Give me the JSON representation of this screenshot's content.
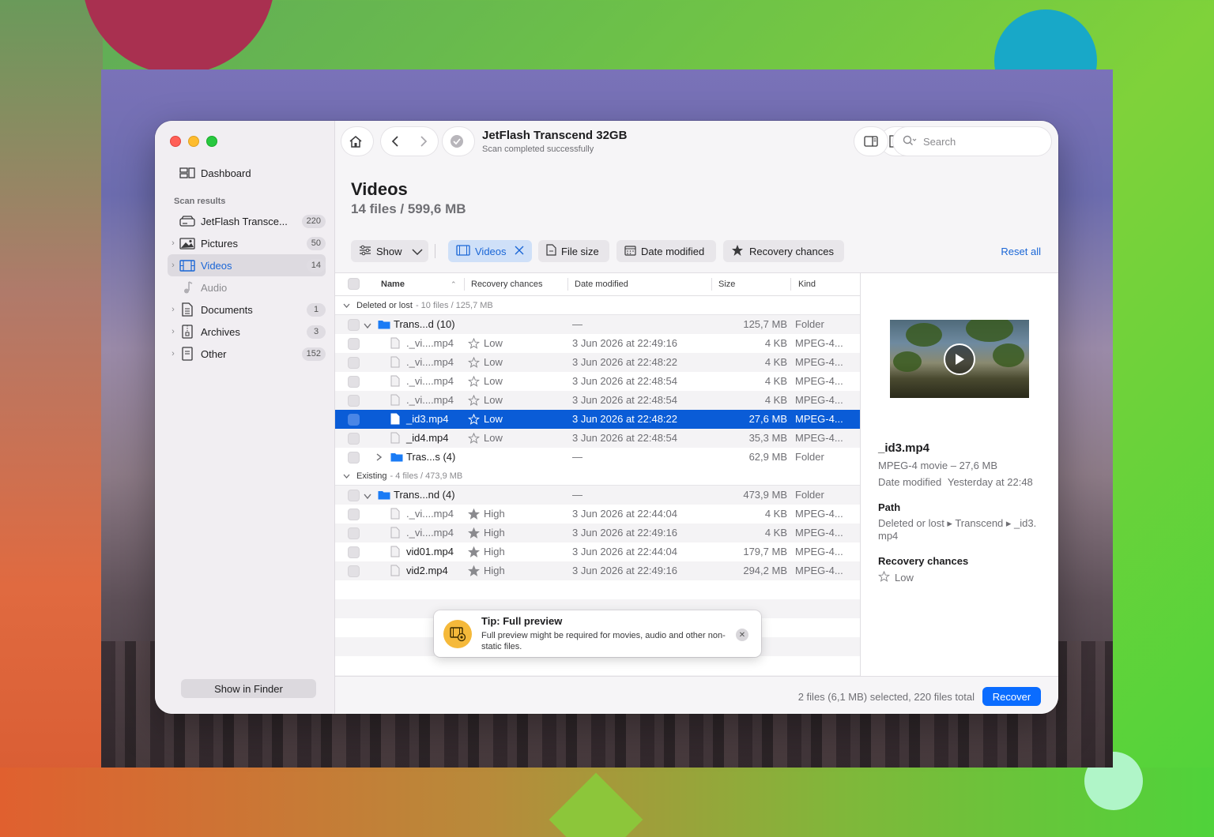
{
  "toolbar": {
    "drive_title": "JetFlash Transcend 32GB",
    "status": "Scan completed successfully",
    "search_placeholder": "Search"
  },
  "sidebar": {
    "dashboard": "Dashboard",
    "section_label": "Scan results",
    "items": [
      {
        "label": "JetFlash Transce...",
        "count": "220",
        "icon": "drive-icon"
      },
      {
        "label": "Pictures",
        "count": "50",
        "icon": "pictures-icon"
      },
      {
        "label": "Videos",
        "count": "14",
        "icon": "film-icon"
      },
      {
        "label": "Audio",
        "count": "",
        "icon": "music-note-icon"
      },
      {
        "label": "Documents",
        "count": "1",
        "icon": "document-icon"
      },
      {
        "label": "Archives",
        "count": "3",
        "icon": "archive-icon"
      },
      {
        "label": "Other",
        "count": "152",
        "icon": "other-icon"
      }
    ],
    "show_in_finder": "Show in Finder"
  },
  "header": {
    "title": "Videos",
    "subtitle": "14 files / 599,6 MB"
  },
  "filters": {
    "show": "Show",
    "videos": "Videos",
    "file_size": "File size",
    "date_modified": "Date modified",
    "recovery_chances": "Recovery chances",
    "reset_all": "Reset all"
  },
  "table": {
    "columns": [
      "Name",
      "Recovery chances",
      "Date modified",
      "Size",
      "Kind"
    ],
    "groups": [
      {
        "label": "Deleted or lost",
        "meta": "- 10 files / 125,7 MB"
      },
      {
        "label": "Existing",
        "meta": "- 4 files / 473,9 MB"
      }
    ],
    "rows_deleted": [
      {
        "name": "Trans...d (10)",
        "chance": "",
        "date": "—",
        "size": "125,7 MB",
        "kind": "Folder"
      },
      {
        "name": "._vi....mp4",
        "chance": "Low",
        "date": "3 Jun 2026 at 22:49:16",
        "size": "4 KB",
        "kind": "MPEG-4..."
      },
      {
        "name": "._vi....mp4",
        "chance": "Low",
        "date": "3 Jun 2026 at 22:48:22",
        "size": "4 KB",
        "kind": "MPEG-4..."
      },
      {
        "name": "._vi....mp4",
        "chance": "Low",
        "date": "3 Jun 2026 at 22:48:54",
        "size": "4 KB",
        "kind": "MPEG-4..."
      },
      {
        "name": "._vi....mp4",
        "chance": "Low",
        "date": "3 Jun 2026 at 22:48:54",
        "size": "4 KB",
        "kind": "MPEG-4..."
      },
      {
        "name": "_id3.mp4",
        "chance": "Low",
        "date": "3 Jun 2026 at 22:48:22",
        "size": "27,6 MB",
        "kind": "MPEG-4..."
      },
      {
        "name": "_id4.mp4",
        "chance": "Low",
        "date": "3 Jun 2026 at 22:48:54",
        "size": "35,3 MB",
        "kind": "MPEG-4..."
      },
      {
        "name": "Tras...s (4)",
        "chance": "",
        "date": "—",
        "size": "62,9 MB",
        "kind": "Folder"
      }
    ],
    "rows_existing": [
      {
        "name": "Trans...nd (4)",
        "chance": "",
        "date": "—",
        "size": "473,9 MB",
        "kind": "Folder"
      },
      {
        "name": "._vi....mp4",
        "chance": "High",
        "date": "3 Jun 2026 at 22:44:04",
        "size": "4 KB",
        "kind": "MPEG-4..."
      },
      {
        "name": "._vi....mp4",
        "chance": "High",
        "date": "3 Jun 2026 at 22:49:16",
        "size": "4 KB",
        "kind": "MPEG-4..."
      },
      {
        "name": "vid01.mp4",
        "chance": "High",
        "date": "3 Jun 2026 at 22:44:04",
        "size": "179,7 MB",
        "kind": "MPEG-4..."
      },
      {
        "name": "vid2.mp4",
        "chance": "High",
        "date": "3 Jun 2026 at 22:49:16",
        "size": "294,2 MB",
        "kind": "MPEG-4..."
      }
    ]
  },
  "preview": {
    "name": "_id3.mp4",
    "kind_size": "MPEG-4 movie – 27,6 MB",
    "date_label": "Date modified",
    "date_value": "Yesterday at 22:48",
    "path_label": "Path",
    "path_value": "Deleted or lost ▸ Transcend ▸ _id3.",
    "path_value_2": "mp4",
    "chances_label": "Recovery chances",
    "chances_value": "Low"
  },
  "tip": {
    "title": "Tip: Full preview",
    "text": "Full preview might be required for movies, audio and other non-static files."
  },
  "footer": {
    "summary": "2 files (6,1 MB) selected, 220 files total",
    "recover": "Recover"
  },
  "colors": {
    "accent": "#0a6cff",
    "selection": "#0a5cd7",
    "tip_icon": "#f5b93a"
  }
}
